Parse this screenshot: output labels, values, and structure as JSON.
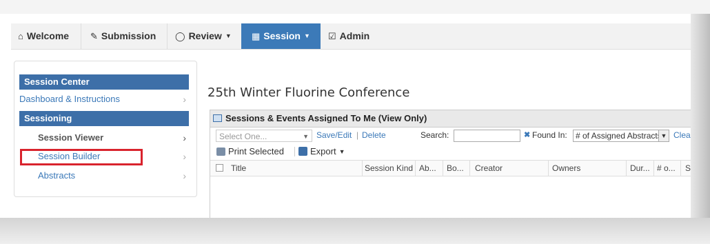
{
  "nav": {
    "welcome": {
      "label": "Welcome",
      "icon": "home-icon"
    },
    "submission": {
      "label": "Submission",
      "icon": "pencil-icon"
    },
    "review": {
      "label": "Review",
      "icon": "comment-icon"
    },
    "session": {
      "label": "Session",
      "icon": "calendar-icon"
    },
    "admin": {
      "label": "Admin",
      "icon": "check-square-icon"
    }
  },
  "sidebar": {
    "heading_center": "Session Center",
    "dashboard": "Dashboard & Instructions",
    "heading_sessioning": "Sessioning",
    "session_viewer": "Session Viewer",
    "session_builder": "Session Builder",
    "abstracts": "Abstracts"
  },
  "main": {
    "title": "25th Winter Fluorine Conference",
    "panel_title": "Sessions & Events Assigned To Me (View Only)",
    "select_placeholder": "Select One...",
    "save_edit": "Save/Edit",
    "delete": "Delete",
    "search_label": "Search:",
    "found_in_label": "Found In:",
    "found_in_value": "# of Assigned Abstracts",
    "clear_label": "Clea",
    "print_selected": "Print Selected",
    "export": "Export",
    "columns": [
      "Title",
      "Session Kind",
      "Ab...",
      "Bo...",
      "Creator",
      "Owners",
      "Dur...",
      "# o...",
      "S"
    ]
  },
  "colors": {
    "accent": "#3c7ab8",
    "header_blue": "#3d6fa8",
    "highlight": "#d9232d",
    "link": "#3a78b8"
  }
}
